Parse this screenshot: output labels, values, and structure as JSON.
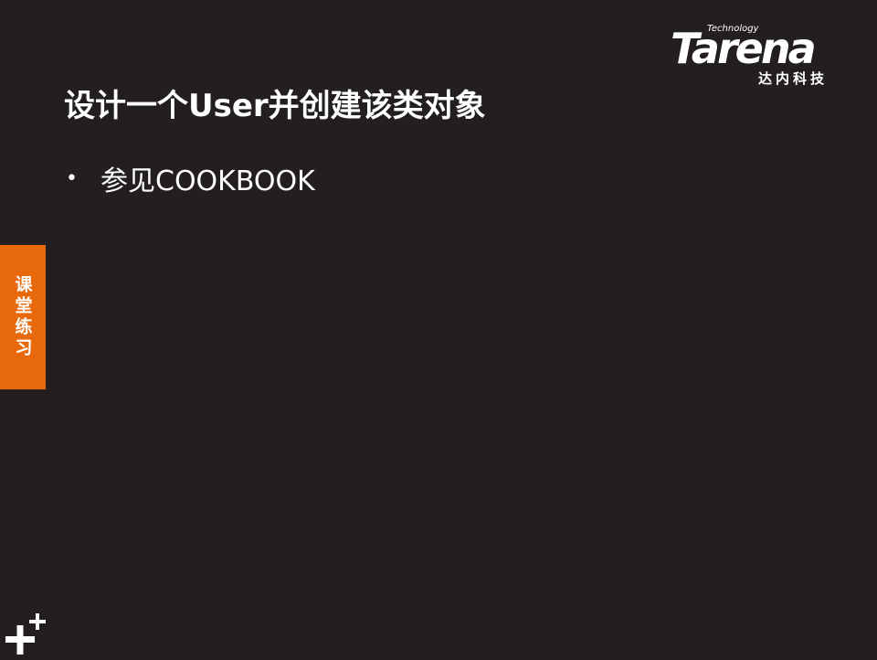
{
  "logo": {
    "tagline": "Technology",
    "brand": "Tarena",
    "chinese": "达内科技"
  },
  "slide": {
    "title": "设计一个User并创建该类对象",
    "bullets": [
      {
        "symbol": "•",
        "text": "参见COOKBOOK"
      }
    ]
  },
  "side_tab": {
    "label": "课堂练习",
    "color": "#e8680c"
  },
  "colors": {
    "background": "#231f20",
    "text": "#ffffff",
    "accent": "#e8680c"
  },
  "icons": {
    "corner": "plus-plus-icon"
  }
}
